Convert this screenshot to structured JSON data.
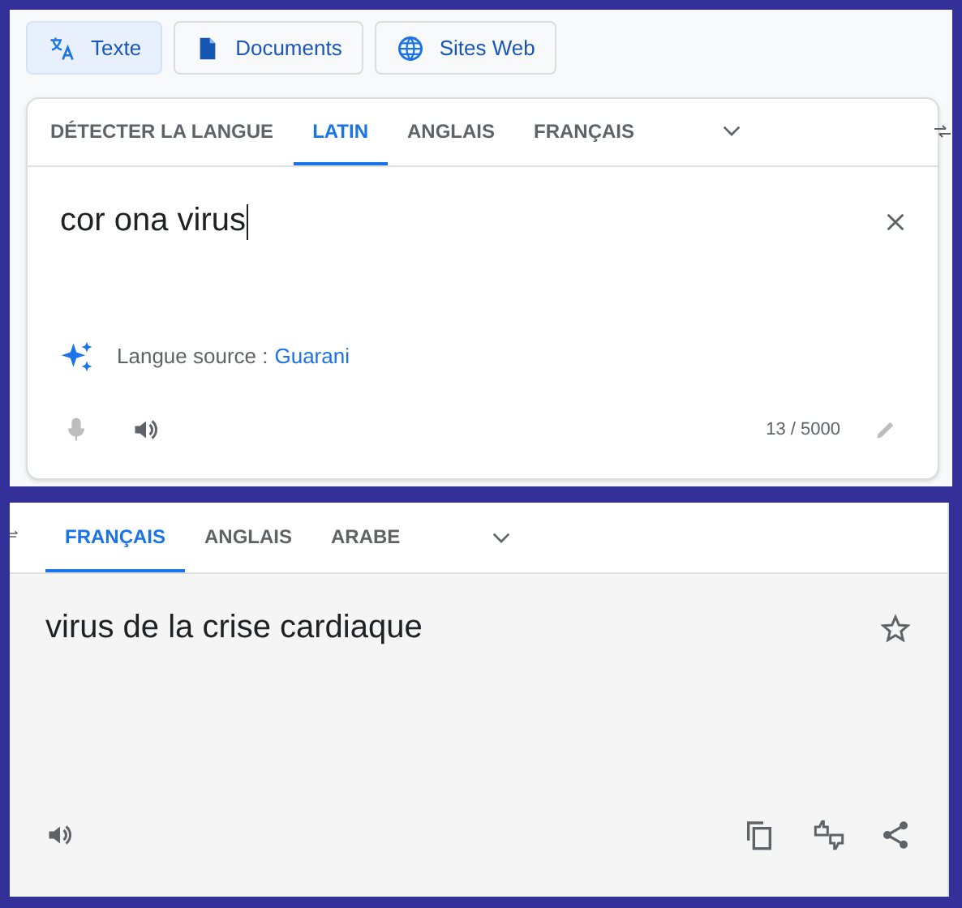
{
  "modes": [
    {
      "kind": "text",
      "label": "Texte",
      "selected": true
    },
    {
      "kind": "document",
      "label": "Documents",
      "selected": false
    },
    {
      "kind": "web",
      "label": "Sites Web",
      "selected": false
    }
  ],
  "source": {
    "tabs": [
      {
        "label": "DÉTECTER LA LANGUE",
        "selected": false
      },
      {
        "label": "LATIN",
        "selected": true
      },
      {
        "label": "ANGLAIS",
        "selected": false
      },
      {
        "label": "FRANÇAIS",
        "selected": false
      }
    ],
    "input": {
      "value": "cor ona virus"
    },
    "detected": {
      "label": "Langue source :",
      "language": "Guarani"
    },
    "counter": "13 / 5000"
  },
  "target": {
    "tabs": [
      {
        "label": "FRANÇAIS",
        "selected": true
      },
      {
        "label": "ANGLAIS",
        "selected": false
      },
      {
        "label": "ARABE",
        "selected": false
      }
    ],
    "translation": "virus de la crise cardiaque"
  }
}
